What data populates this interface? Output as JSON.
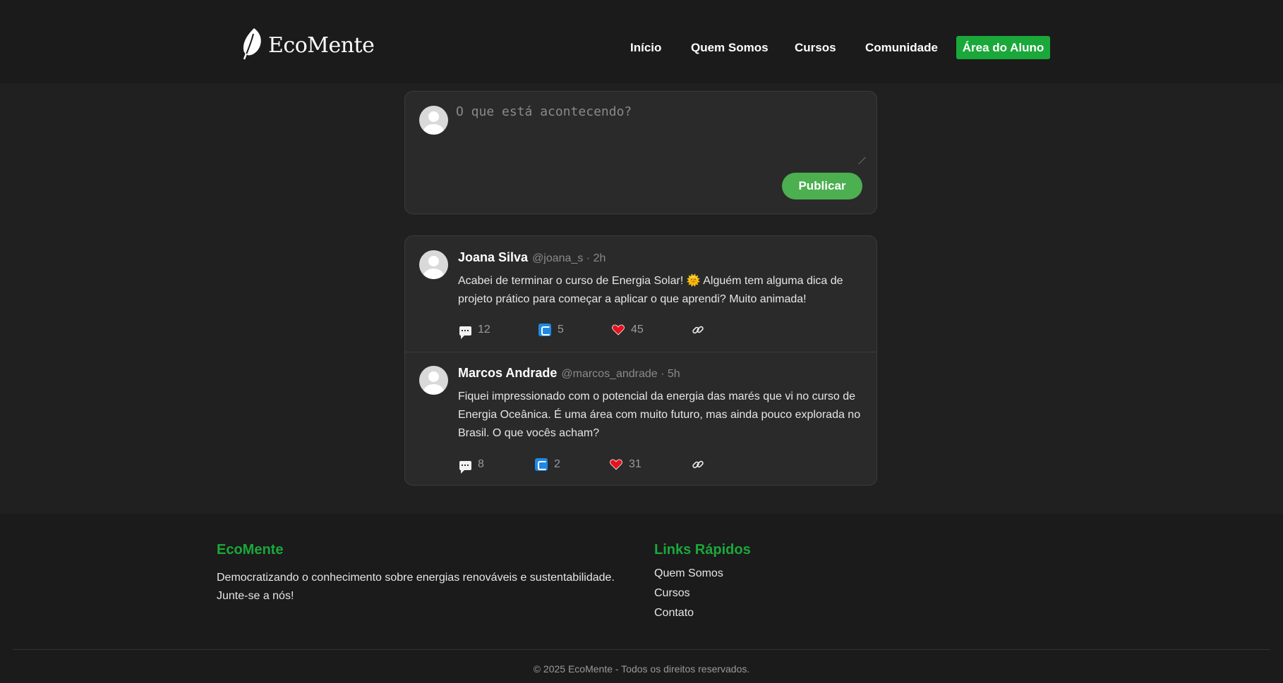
{
  "brand": {
    "name": "EcoMente",
    "logo_icon": "leaf-icon"
  },
  "nav": {
    "links": [
      "Início",
      "Quem Somos",
      "Cursos",
      "Comunidade"
    ],
    "cta": "Área do Aluno",
    "cta_color": "#1aa83a"
  },
  "composer": {
    "placeholder": "O que está acontecendo?",
    "publish_label": "Publicar",
    "publish_color": "#4caf50"
  },
  "posts": [
    {
      "author": "Joana Silva",
      "meta": "@joana_s · 2h",
      "text": "Acabei de terminar o curso de Energia Solar! 🌞 Alguém tem alguma dica de projeto prático para começar a aplicar o que aprendi? Muito animada!",
      "comments": "12",
      "reposts": "5",
      "likes": "45"
    },
    {
      "author": "Marcos Andrade",
      "meta": "@marcos_andrade · 5h",
      "text": "Fiquei impressionado com o potencial da energia das marés que vi no curso de Energia Oceânica. É uma área com muito futuro, mas ainda pouco explorada no Brasil. O que vocês acham?",
      "comments": "8",
      "reposts": "2",
      "likes": "31"
    }
  ],
  "footer": {
    "about_title": "EcoMente",
    "about_text": "Democratizando o conhecimento sobre energias renováveis e sustentabilidade. Junte-se a nós!",
    "links_title": "Links Rápidos",
    "links": [
      "Quem Somos",
      "Cursos",
      "Contato"
    ],
    "copyright": "© 2025 EcoMente - Todos os direitos reservados."
  }
}
